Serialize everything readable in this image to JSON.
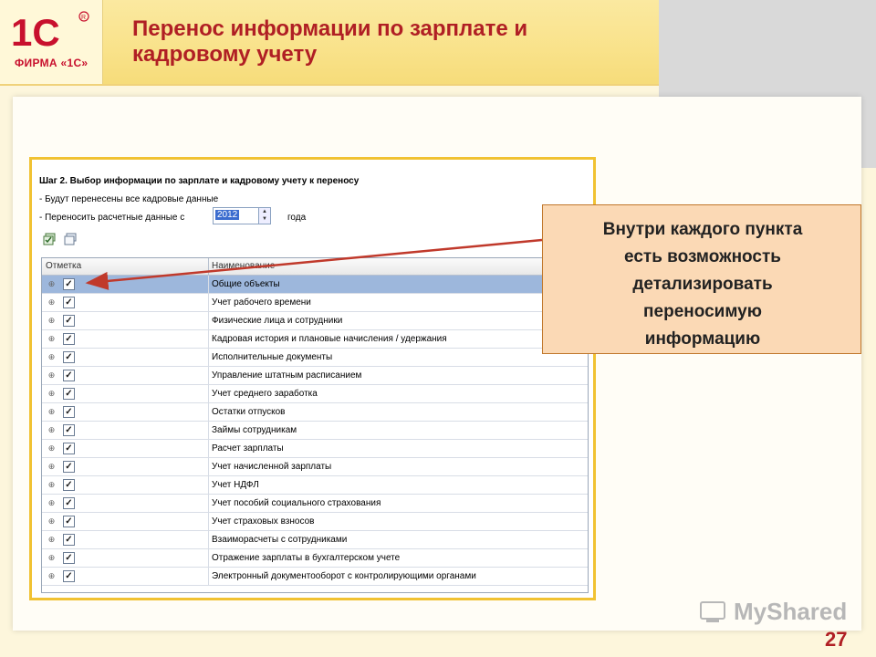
{
  "header": {
    "title_line1": "Перенос информации по зарплате и",
    "title_line2": "кадровому учету",
    "logo_text": "ФИРМА «1С»"
  },
  "window": {
    "step_title": "Шаг 2. Выбор информации по зарплате и кадровому учету к переносу",
    "line1": "- Будут перенесены все кадровые данные",
    "line2": "- Переносить расчетные данные с",
    "year_value": "2012",
    "year_suffix": "года",
    "columns": {
      "mark": "Отметка",
      "name": "Наименование"
    },
    "rows": [
      {
        "name": "Общие объекты",
        "checked": true,
        "selected": true
      },
      {
        "name": "Учет рабочего времени",
        "checked": true
      },
      {
        "name": "Физические лица и сотрудники",
        "checked": true
      },
      {
        "name": "Кадровая история и плановые начисления / удержания",
        "checked": true
      },
      {
        "name": "Исполнительные документы",
        "checked": true
      },
      {
        "name": "Управление штатным расписанием",
        "checked": true
      },
      {
        "name": "Учет среднего заработка",
        "checked": true
      },
      {
        "name": "Остатки отпусков",
        "checked": true
      },
      {
        "name": "Займы сотрудникам",
        "checked": true
      },
      {
        "name": "Расчет зарплаты",
        "checked": true
      },
      {
        "name": "Учет начисленной зарплаты",
        "checked": true
      },
      {
        "name": "Учет НДФЛ",
        "checked": true
      },
      {
        "name": "Учет пособий социального страхования",
        "checked": true
      },
      {
        "name": "Учет страховых взносов",
        "checked": true
      },
      {
        "name": "Взаиморасчеты с сотрудниками",
        "checked": true
      },
      {
        "name": "Отражение зарплаты в бухгалтерском учете",
        "checked": true
      },
      {
        "name": "Электронный документооборот с контролирующими органами",
        "checked": true
      }
    ]
  },
  "callout": {
    "text_lines": [
      "Внутри каждого пункта",
      "есть возможность",
      "детализировать",
      "переносимую",
      "информацию"
    ]
  },
  "watermark": "MyShared",
  "page_number": "27",
  "colors": {
    "title": "#b01f24",
    "header_bg": "#f9e28a",
    "window_border": "#f1c232",
    "callout_bg": "#fbd9b5",
    "selected_row": "#9db7dc"
  }
}
